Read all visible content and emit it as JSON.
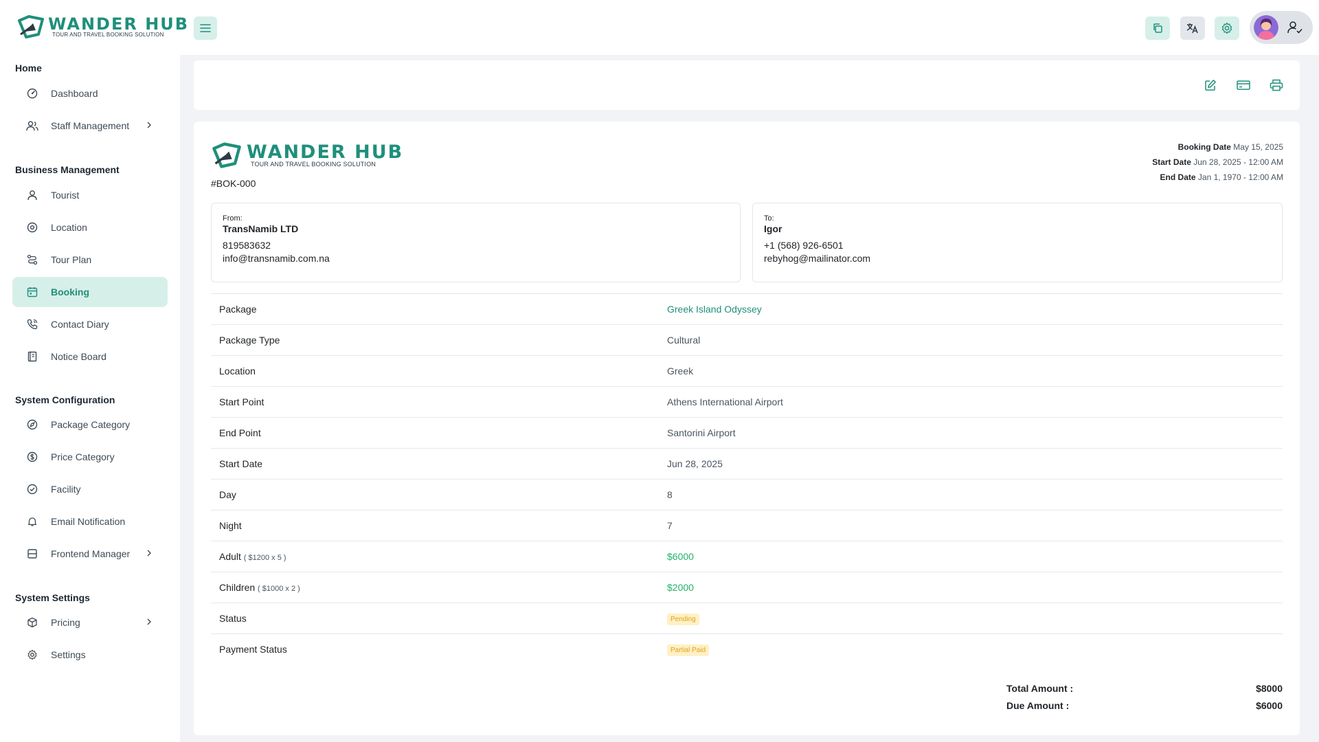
{
  "brand": {
    "name": "WANDER HUB",
    "tagline": "TOUR AND TRAVEL BOOKING SOLUTION",
    "color": "#1f8f7b"
  },
  "header": {
    "icons": [
      "menu-icon",
      "copy-icon",
      "translate-icon",
      "settings-icon",
      "user-check-icon"
    ]
  },
  "sidebar": {
    "sections": [
      {
        "title": "Home"
      },
      {
        "title": "Business Management"
      },
      {
        "title": "System Configuration"
      },
      {
        "title": "System Settings"
      }
    ],
    "items": [
      {
        "label": "Dashboard",
        "icon": "dashboard-icon"
      },
      {
        "label": "Staff Management",
        "icon": "users-icon",
        "has_submenu": true
      },
      {
        "label": "Tourist",
        "icon": "user-icon"
      },
      {
        "label": "Location",
        "icon": "location-icon"
      },
      {
        "label": "Tour Plan",
        "icon": "route-icon"
      },
      {
        "label": "Booking",
        "icon": "calendar-icon",
        "active": true
      },
      {
        "label": "Contact Diary",
        "icon": "phone-icon"
      },
      {
        "label": "Notice Board",
        "icon": "notice-icon"
      },
      {
        "label": "Package Category",
        "icon": "compass-icon"
      },
      {
        "label": "Price Category",
        "icon": "dollar-icon"
      },
      {
        "label": "Facility",
        "icon": "check-circle-icon"
      },
      {
        "label": "Email Notification",
        "icon": "bell-icon"
      },
      {
        "label": "Frontend Manager",
        "icon": "layout-icon",
        "has_submenu": true
      },
      {
        "label": "Pricing",
        "icon": "box-icon",
        "has_submenu": true
      },
      {
        "label": "Settings",
        "icon": "gear-icon"
      }
    ]
  },
  "toolbar": {
    "icons": [
      "edit-icon",
      "payment-card-icon",
      "print-icon"
    ]
  },
  "invoice": {
    "booking_id": "#BOK-000",
    "booking_date_label": "Booking Date",
    "booking_date": "May 15, 2025",
    "start_date_label": "Start Date",
    "start_date": "Jun 28, 2025 - 12:00 AM",
    "end_date_label": "End Date",
    "end_date": "Jan 1, 1970 - 12:00 AM",
    "from": {
      "label": "From:",
      "name": "TransNamib LTD",
      "phone": "819583632",
      "email": "info@transnamib.com.na"
    },
    "to": {
      "label": "To:",
      "name": "Igor",
      "phone": "+1 (568) 926-6501",
      "email": "rebyhog@mailinator.com"
    },
    "details": [
      {
        "label": "Package",
        "value": "Greek Island Odyssey"
      },
      {
        "label": "Package Type",
        "value": "Cultural"
      },
      {
        "label": "Location",
        "value": "Greek"
      },
      {
        "label": "Start Point",
        "value": "Athens International Airport"
      },
      {
        "label": "End Point",
        "value": "Santorini Airport"
      },
      {
        "label": "Start Date",
        "value": "Jun 28, 2025"
      },
      {
        "label": "Day",
        "value": "8"
      },
      {
        "label": "Night",
        "value": "7"
      },
      {
        "label": "Adult",
        "sub": "( $1200 x 5 )",
        "value": "$6000"
      },
      {
        "label": "Children",
        "sub": "( $1000 x 2 )",
        "value": "$2000"
      },
      {
        "label": "Status",
        "value": "Pending"
      },
      {
        "label": "Payment Status",
        "value": "Partial Paid"
      }
    ],
    "total_label": "Total Amount :",
    "total_value": "$8000",
    "due_label": "Due Amount :",
    "due_value": "$6000"
  }
}
